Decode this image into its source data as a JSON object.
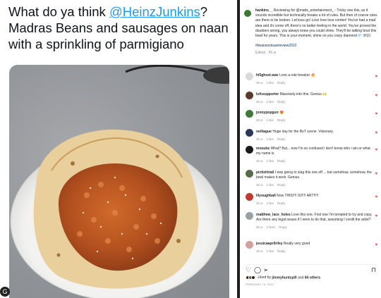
{
  "tweet": {
    "text_before": "What do ya think ",
    "mention": "@HeinzJunkins",
    "text_after": "? Madras Beans and sausages on naan with a sprinkling of parmigiano",
    "profile_initial": "G"
  },
  "instagram": {
    "caption": {
      "username": "hankins__",
      "text": "Reviewing for @matts_entertainment_ - Tricky one this, as it sounds incredible but technically breaks a lot of rules. But then of course rules are there to be broken. Let'ssss go! Love love love combo! You've had a mad idea and it's come off, there's no better feeling in the world. You've proved the doubters wrong, you always knew you could shine. They'll be talking bout this bowl for years. This is your moment, shine on you crazy diamond 💎 9/10.",
      "hashtag": "#beansontoastreview2022",
      "edited": "Edited · 45 w"
    },
    "comments": [
      {
        "user": "hi5ghost.wav",
        "text": "Love a rule breaker 🔥",
        "time": "45 w",
        "likes": "1 like",
        "reply": "Reply",
        "avatar_color": "#d9d9d9"
      },
      {
        "user": "lufcsupporter",
        "text": "Massively into this. Genius 🙌",
        "time": "45 w",
        "likes": "1 like",
        "reply": "Reply",
        "avatar_color": "#5a3b2a"
      },
      {
        "user": "jonnypopgun",
        "text": "😍",
        "time": "45 w",
        "likes": "1 like",
        "reply": "Reply",
        "avatar_color": "#3f7a3a"
      },
      {
        "user": "neiltague",
        "text": "Huge day for the BoT scene. Visionary.",
        "time": "45 w",
        "likes": "1 like",
        "reply": "Reply",
        "avatar_color": "#2b3a5c"
      },
      {
        "user": "mosubs",
        "text": "What? But... now I'm so confused i don't know who i am or what my name is",
        "time": "45 w",
        "likes": "1 like",
        "reply": "Reply",
        "avatar_color": "#1a1a1a"
      },
      {
        "user": "pictishtrail",
        "text": "I was going to slag this one off ... but somehow, somehow, the bowl makes it work. Genius.",
        "time": "45 w",
        "likes": "1 like",
        "reply": "Reply",
        "avatar_color": "#556b4a"
      },
      {
        "user": "lilyoughball",
        "text": "Now THIS!!!! IS!!!!! ART!!!!!",
        "time": "45 w",
        "likes": "1 like",
        "reply": "Reply",
        "avatar_color": "#c0392b"
      },
      {
        "user": "matthew_lace_holes",
        "text": "Love this one. First one I'm tempted to try and copy. Are there any legal issues if I were to do that, assuming I credit the artist?",
        "time": "45 w",
        "likes": "2 likes",
        "reply": "Reply",
        "avatar_color": "#9aa0a6"
      },
      {
        "user": "jessicaaprilriley",
        "text": "Really very good",
        "time": "45 w",
        "likes": "1 like",
        "reply": "Reply",
        "avatar_color": "#d4a0a0"
      }
    ],
    "likes": {
      "liked_by_prefix": "Liked by ",
      "liked_by_user": "jimmyhuntspill",
      "and": " and ",
      "others": "84 others"
    },
    "date": "FEBRUARY 19, 2022",
    "icons": [
      "heart-icon",
      "comment-icon",
      "share-icon",
      "bookmark-icon"
    ],
    "colors": {
      "heart": "#ed4956",
      "link": "#1d9bf0",
      "divider": "#1f1f1f"
    }
  }
}
